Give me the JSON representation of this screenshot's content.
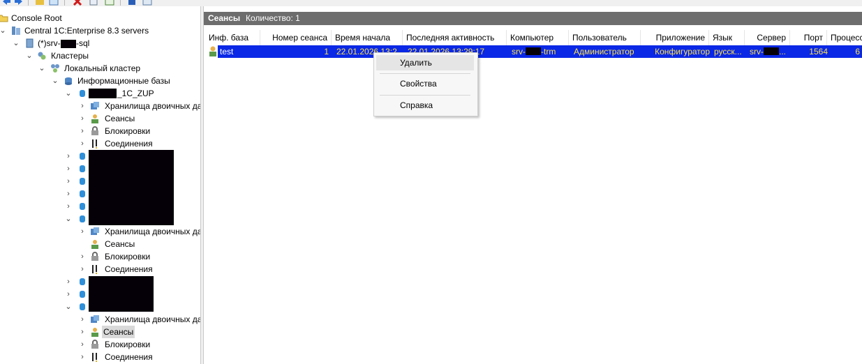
{
  "toolbar": {
    "buttons": [
      "back-icon",
      "forward-icon",
      "folder-icon",
      "view-icon",
      "delete-icon",
      "copy-icon",
      "export-icon",
      "help-icon",
      "properties-icon"
    ]
  },
  "tree": {
    "root": "Console Root",
    "servers": "Central 1C:Enterprise 8.3 servers",
    "server_prefix": "(*)srv-",
    "server_suffix": "-sql",
    "clusters": "Кластеры",
    "local_cluster": "Локальный кластер",
    "infobases": "Информационные базы",
    "db1_suffix": "_1C_ZUP",
    "storage": "Хранилища двоичных данных",
    "sessions": "Сеансы",
    "locks": "Блокировки",
    "connections": "Соединения"
  },
  "panel": {
    "title": "Сеансы",
    "count": "Количество: 1"
  },
  "columns": [
    "Инф. база",
    "Номер сеанса",
    "Время начала",
    "Последняя активность",
    "Компьютер",
    "Пользователь",
    "Приложение",
    "Язык",
    "Сервер",
    "Порт",
    "Процесс"
  ],
  "row": {
    "infobase": "test",
    "session_number": "1",
    "start_time": "22.01.2026 13:2",
    "last_activity": "22.01.2026 13:29:17",
    "computer_prefix": "srv-",
    "computer_suffix": "-trm",
    "user": "Администратор",
    "application": "Конфигуратор",
    "language": "русск...",
    "server_prefix": "srv-",
    "server_suffix": "...",
    "port": "1564",
    "process": "6"
  },
  "context_menu": {
    "delete": "Удалить",
    "properties": "Свойства",
    "help": "Справка"
  },
  "colors": {
    "selection": "#0a28e6",
    "selection_text": "#ffe34a",
    "title_bar": "#6d6d6d"
  }
}
